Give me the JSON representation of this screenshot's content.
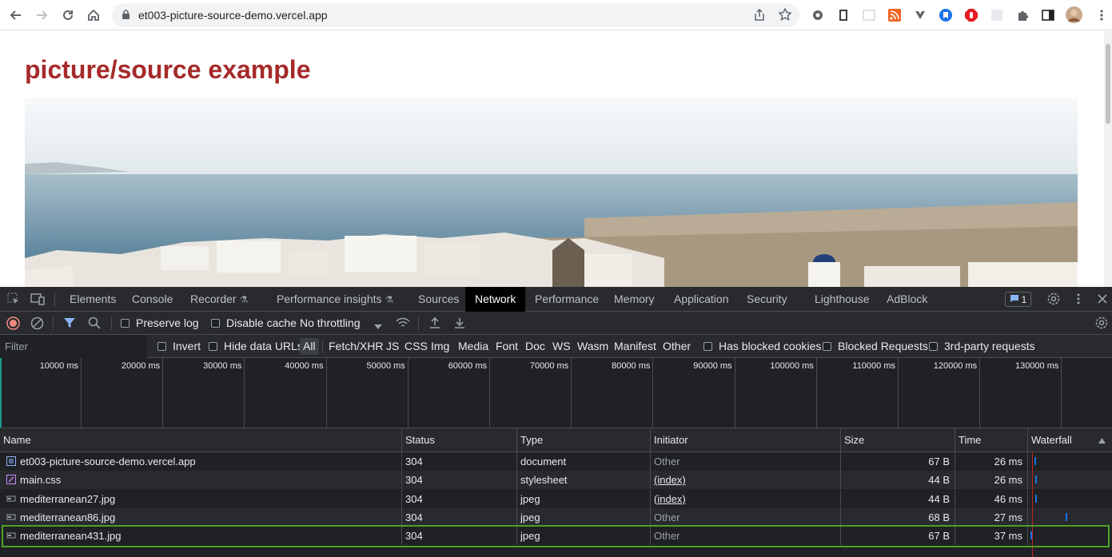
{
  "browser": {
    "url": "et003-picture-source-demo.vercel.app",
    "extensions": [
      "settings-gear-icon",
      "reader-icon",
      "sidebar-icon",
      "rss-icon",
      "vimeo-icon",
      "bookmark-icon",
      "adblock-icon",
      "blank-icon",
      "puzzle-icon",
      "split-view-icon",
      "profile-avatar",
      "more-menu-icon"
    ]
  },
  "page": {
    "title": "picture/source example"
  },
  "devtools": {
    "tabs": [
      "Elements",
      "Console",
      "Recorder",
      "Performance insights",
      "Sources",
      "Network",
      "Performance",
      "Memory",
      "Application",
      "Security",
      "Lighthouse",
      "AdBlock"
    ],
    "active_tab": "Network",
    "issues_count": "1",
    "toolbar": {
      "preserve_log": "Preserve log",
      "disable_cache": "Disable cache",
      "throttling": "No throttling"
    },
    "filter_bar": {
      "placeholder": "Filter",
      "invert": "Invert",
      "hide_data_urls": "Hide data URLs",
      "types": [
        "All",
        "Fetch/XHR",
        "JS",
        "CSS",
        "Img",
        "Media",
        "Font",
        "Doc",
        "WS",
        "Wasm",
        "Manifest",
        "Other"
      ],
      "has_blocked_cookies": "Has blocked cookies",
      "blocked_requests": "Blocked Requests",
      "third_party": "3rd-party requests"
    },
    "overview_ticks": [
      "10000 ms",
      "20000 ms",
      "30000 ms",
      "40000 ms",
      "50000 ms",
      "60000 ms",
      "70000 ms",
      "80000 ms",
      "90000 ms",
      "100000 ms",
      "110000 ms",
      "120000 ms",
      "130000 ms",
      "140"
    ],
    "columns": [
      "Name",
      "Status",
      "Type",
      "Initiator",
      "Size",
      "Time",
      "Waterfall"
    ],
    "rows": [
      {
        "name": "et003-picture-source-demo.vercel.app",
        "status": "304",
        "type": "document",
        "initiator": "Other",
        "size": "67 B",
        "time": "26 ms",
        "icon": "document-icon"
      },
      {
        "name": "main.css",
        "status": "304",
        "type": "stylesheet",
        "initiator": "(index)",
        "size": "44 B",
        "time": "26 ms",
        "icon": "stylesheet-icon"
      },
      {
        "name": "mediterranean27.jpg",
        "status": "304",
        "type": "jpeg",
        "initiator": "(index)",
        "size": "44 B",
        "time": "46 ms",
        "icon": "image-icon"
      },
      {
        "name": "mediterranean86.jpg",
        "status": "304",
        "type": "jpeg",
        "initiator": "Other",
        "size": "68 B",
        "time": "27 ms",
        "icon": "image-icon"
      },
      {
        "name": "mediterranean431.jpg",
        "status": "304",
        "type": "jpeg",
        "initiator": "Other",
        "size": "67 B",
        "time": "37 ms",
        "icon": "image-icon"
      }
    ]
  }
}
